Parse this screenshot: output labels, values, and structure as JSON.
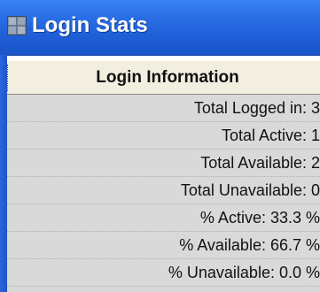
{
  "window": {
    "title": "Login Stats",
    "icon": "app-window-icon"
  },
  "table": {
    "header": "Login Information",
    "rows": [
      "Total Logged in: 3",
      "Total Active: 1",
      "Total Available: 2",
      "Total Unavailable: 0",
      "% Active: 33.3 %",
      "% Available: 66.7 %",
      "% Unavailable: 0.0 %"
    ]
  },
  "colors": {
    "titlebar": "#1f5fd8",
    "header_bg": "#f3efe0",
    "row_bg": "#d9d9d9"
  }
}
